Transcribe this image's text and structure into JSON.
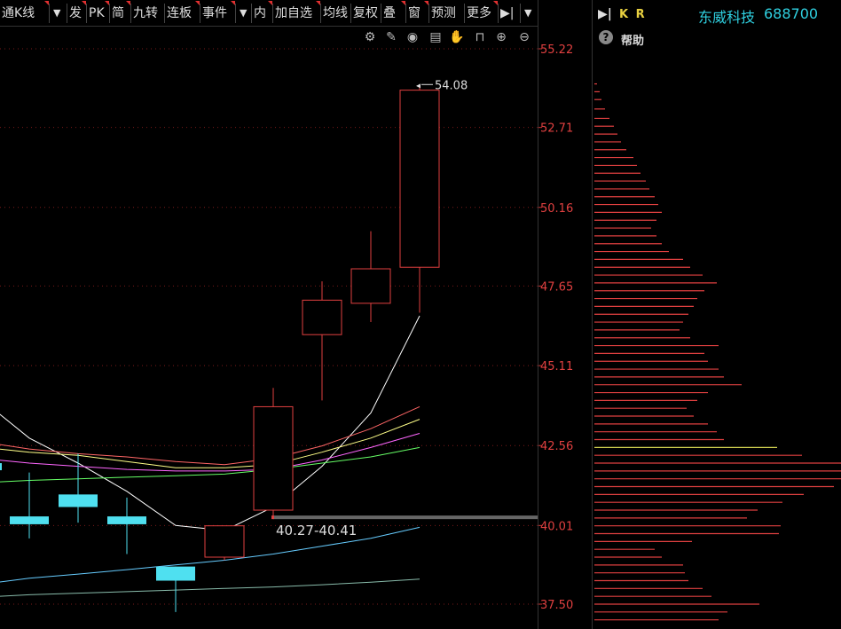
{
  "toolbar": {
    "items": [
      "通K线",
      "▼",
      "发",
      "PK",
      "简",
      "九转",
      "连板",
      "事件",
      "▼",
      "内",
      "加自选",
      "均线",
      "复权",
      "叠",
      "窗",
      "预测",
      "更多",
      "▶|",
      "▼"
    ]
  },
  "icon_names": [
    "gear-icon",
    "pen-icon",
    "eye-icon",
    "box-icon",
    "hand-icon",
    "lock-icon",
    "zoom-in-icon",
    "zoom-out-icon"
  ],
  "right_panel": {
    "kr_label": "K R",
    "stock_name": "东威科技",
    "stock_code": "688700",
    "help_label": "帮助",
    "name_color": "#2fd0e0"
  },
  "chart_data": {
    "type": "candlestick",
    "y_ticks": [
      "55.22",
      "52.71",
      "50.16",
      "47.65",
      "45.11",
      "42.56",
      "40.01",
      "37.50"
    ],
    "ylim": [
      37.5,
      55.22
    ],
    "candles": [
      {
        "open": 42.0,
        "close": 42.0,
        "high": 43.5,
        "low": 41.0,
        "color": "cyan",
        "x": 0
      },
      {
        "open": 40.3,
        "close": 40.05,
        "high": 41.7,
        "low": 39.6,
        "color": "cyan",
        "x": 1
      },
      {
        "open": 41.0,
        "close": 40.6,
        "high": 42.3,
        "low": 40.1,
        "color": "cyan",
        "x": 2
      },
      {
        "open": 40.3,
        "close": 40.05,
        "high": 40.9,
        "low": 39.1,
        "color": "cyan",
        "x": 3
      },
      {
        "open": 38.7,
        "close": 38.25,
        "high": 38.7,
        "low": 37.25,
        "color": "cyan",
        "x": 4
      },
      {
        "open": 39.0,
        "close": 40.0,
        "high": 40.0,
        "low": 38.9,
        "color": "red",
        "x": 5
      },
      {
        "open": 40.5,
        "close": 43.8,
        "high": 44.4,
        "low": 40.27,
        "color": "red",
        "x": 6
      },
      {
        "open": 46.1,
        "close": 47.2,
        "high": 47.8,
        "low": 44.0,
        "color": "red",
        "x": 7
      },
      {
        "open": 47.1,
        "close": 48.2,
        "high": 49.4,
        "low": 46.5,
        "color": "red",
        "x": 8
      },
      {
        "open": 48.25,
        "close": 53.9,
        "high": 54.08,
        "low": 46.8,
        "color": "red",
        "x": 9
      }
    ],
    "annotations": {
      "high_label": "54.08",
      "range_label": "40.27-40.41",
      "range_price": 40.27
    },
    "ma_lines": [
      {
        "color": "#ffffff",
        "values": [
          43.6,
          42.8,
          42.0,
          41.1,
          40.01,
          39.85,
          40.6,
          41.9,
          43.6,
          46.7
        ]
      },
      {
        "color": "#ff6666",
        "values": [
          42.6,
          42.45,
          42.3,
          42.2,
          42.05,
          41.95,
          42.15,
          42.55,
          43.1,
          43.8
        ]
      },
      {
        "color": "#ffff88",
        "values": [
          42.45,
          42.35,
          42.25,
          42.05,
          41.85,
          41.85,
          41.95,
          42.35,
          42.8,
          43.4
        ]
      },
      {
        "color": "#ff66ff",
        "values": [
          42.1,
          42.0,
          41.9,
          41.8,
          41.75,
          41.75,
          41.8,
          42.1,
          42.5,
          42.95
        ]
      },
      {
        "color": "#66ff66",
        "values": [
          41.4,
          41.45,
          41.5,
          41.55,
          41.6,
          41.65,
          41.8,
          42.0,
          42.2,
          42.5
        ]
      },
      {
        "color": "#66ccff",
        "values": [
          38.2,
          38.33,
          38.46,
          38.6,
          38.75,
          38.9,
          39.1,
          39.35,
          39.6,
          39.95
        ]
      },
      {
        "color": "#88bbaa",
        "values": [
          37.75,
          37.8,
          37.85,
          37.9,
          37.95,
          38.0,
          38.05,
          38.12,
          38.2,
          38.3
        ]
      }
    ],
    "volume_profile": [
      {
        "price": 54.1,
        "len": 3
      },
      {
        "price": 53.85,
        "len": 6
      },
      {
        "price": 53.6,
        "len": 8
      },
      {
        "price": 53.3,
        "len": 12
      },
      {
        "price": 53.0,
        "len": 17
      },
      {
        "price": 52.75,
        "len": 22
      },
      {
        "price": 52.5,
        "len": 26
      },
      {
        "price": 52.25,
        "len": 30
      },
      {
        "price": 52.0,
        "len": 36
      },
      {
        "price": 51.75,
        "len": 44
      },
      {
        "price": 51.5,
        "len": 48
      },
      {
        "price": 51.25,
        "len": 52
      },
      {
        "price": 51.0,
        "len": 58
      },
      {
        "price": 50.75,
        "len": 62
      },
      {
        "price": 50.5,
        "len": 68
      },
      {
        "price": 50.25,
        "len": 72
      },
      {
        "price": 50.0,
        "len": 76
      },
      {
        "price": 49.75,
        "len": 70
      },
      {
        "price": 49.5,
        "len": 64
      },
      {
        "price": 49.25,
        "len": 70
      },
      {
        "price": 49.0,
        "len": 76
      },
      {
        "price": 48.75,
        "len": 84
      },
      {
        "price": 48.5,
        "len": 100
      },
      {
        "price": 48.25,
        "len": 108
      },
      {
        "price": 48.0,
        "len": 122
      },
      {
        "price": 47.75,
        "len": 138
      },
      {
        "price": 47.5,
        "len": 124
      },
      {
        "price": 47.25,
        "len": 116
      },
      {
        "price": 47.0,
        "len": 112
      },
      {
        "price": 46.75,
        "len": 106
      },
      {
        "price": 46.5,
        "len": 100
      },
      {
        "price": 46.25,
        "len": 96
      },
      {
        "price": 46.0,
        "len": 108
      },
      {
        "price": 45.75,
        "len": 140
      },
      {
        "price": 45.5,
        "len": 124
      },
      {
        "price": 45.25,
        "len": 128
      },
      {
        "price": 45.0,
        "len": 140
      },
      {
        "price": 44.75,
        "len": 146
      },
      {
        "price": 44.5,
        "len": 166
      },
      {
        "price": 44.25,
        "len": 128
      },
      {
        "price": 44.0,
        "len": 116
      },
      {
        "price": 43.75,
        "len": 104
      },
      {
        "price": 43.5,
        "len": 112
      },
      {
        "price": 43.25,
        "len": 128
      },
      {
        "price": 43.0,
        "len": 138
      },
      {
        "price": 42.75,
        "len": 146
      },
      {
        "price": 42.5,
        "len": 206
      },
      {
        "price": 42.25,
        "len": 234
      },
      {
        "price": 42.0,
        "len": 278
      },
      {
        "price": 41.75,
        "len": 284
      },
      {
        "price": 41.5,
        "len": 282
      },
      {
        "price": 41.25,
        "len": 270
      },
      {
        "price": 41.0,
        "len": 236
      },
      {
        "price": 40.75,
        "len": 212
      },
      {
        "price": 40.5,
        "len": 184
      },
      {
        "price": 40.25,
        "len": 172
      },
      {
        "price": 40.0,
        "len": 210
      },
      {
        "price": 39.75,
        "len": 208
      },
      {
        "price": 39.5,
        "len": 110
      },
      {
        "price": 39.25,
        "len": 68
      },
      {
        "price": 39.0,
        "len": 76
      },
      {
        "price": 38.75,
        "len": 100
      },
      {
        "price": 38.5,
        "len": 102
      },
      {
        "price": 38.25,
        "len": 106
      },
      {
        "price": 38.0,
        "len": 122
      },
      {
        "price": 37.75,
        "len": 132
      },
      {
        "price": 37.5,
        "len": 186
      },
      {
        "price": 37.25,
        "len": 150
      },
      {
        "price": 37.0,
        "len": 140
      }
    ]
  }
}
